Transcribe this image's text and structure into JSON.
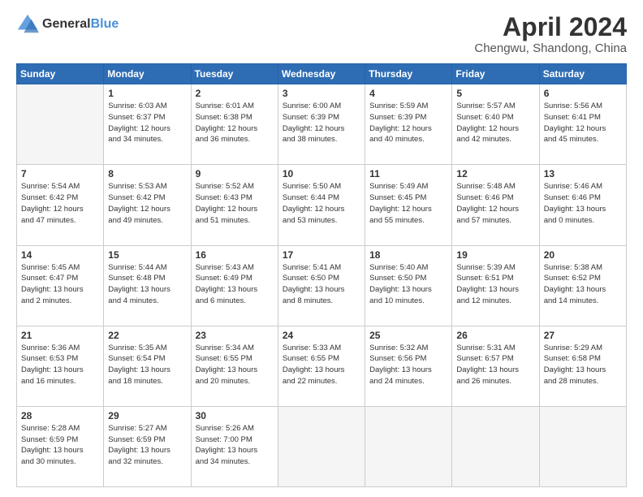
{
  "header": {
    "logo_line1": "General",
    "logo_line2": "Blue",
    "month_title": "April 2024",
    "location": "Chengwu, Shandong, China"
  },
  "days_of_week": [
    "Sunday",
    "Monday",
    "Tuesday",
    "Wednesday",
    "Thursday",
    "Friday",
    "Saturday"
  ],
  "weeks": [
    [
      {
        "day": "",
        "info": ""
      },
      {
        "day": "1",
        "info": "Sunrise: 6:03 AM\nSunset: 6:37 PM\nDaylight: 12 hours\nand 34 minutes."
      },
      {
        "day": "2",
        "info": "Sunrise: 6:01 AM\nSunset: 6:38 PM\nDaylight: 12 hours\nand 36 minutes."
      },
      {
        "day": "3",
        "info": "Sunrise: 6:00 AM\nSunset: 6:39 PM\nDaylight: 12 hours\nand 38 minutes."
      },
      {
        "day": "4",
        "info": "Sunrise: 5:59 AM\nSunset: 6:39 PM\nDaylight: 12 hours\nand 40 minutes."
      },
      {
        "day": "5",
        "info": "Sunrise: 5:57 AM\nSunset: 6:40 PM\nDaylight: 12 hours\nand 42 minutes."
      },
      {
        "day": "6",
        "info": "Sunrise: 5:56 AM\nSunset: 6:41 PM\nDaylight: 12 hours\nand 45 minutes."
      }
    ],
    [
      {
        "day": "7",
        "info": "Sunrise: 5:54 AM\nSunset: 6:42 PM\nDaylight: 12 hours\nand 47 minutes."
      },
      {
        "day": "8",
        "info": "Sunrise: 5:53 AM\nSunset: 6:42 PM\nDaylight: 12 hours\nand 49 minutes."
      },
      {
        "day": "9",
        "info": "Sunrise: 5:52 AM\nSunset: 6:43 PM\nDaylight: 12 hours\nand 51 minutes."
      },
      {
        "day": "10",
        "info": "Sunrise: 5:50 AM\nSunset: 6:44 PM\nDaylight: 12 hours\nand 53 minutes."
      },
      {
        "day": "11",
        "info": "Sunrise: 5:49 AM\nSunset: 6:45 PM\nDaylight: 12 hours\nand 55 minutes."
      },
      {
        "day": "12",
        "info": "Sunrise: 5:48 AM\nSunset: 6:46 PM\nDaylight: 12 hours\nand 57 minutes."
      },
      {
        "day": "13",
        "info": "Sunrise: 5:46 AM\nSunset: 6:46 PM\nDaylight: 13 hours\nand 0 minutes."
      }
    ],
    [
      {
        "day": "14",
        "info": "Sunrise: 5:45 AM\nSunset: 6:47 PM\nDaylight: 13 hours\nand 2 minutes."
      },
      {
        "day": "15",
        "info": "Sunrise: 5:44 AM\nSunset: 6:48 PM\nDaylight: 13 hours\nand 4 minutes."
      },
      {
        "day": "16",
        "info": "Sunrise: 5:43 AM\nSunset: 6:49 PM\nDaylight: 13 hours\nand 6 minutes."
      },
      {
        "day": "17",
        "info": "Sunrise: 5:41 AM\nSunset: 6:50 PM\nDaylight: 13 hours\nand 8 minutes."
      },
      {
        "day": "18",
        "info": "Sunrise: 5:40 AM\nSunset: 6:50 PM\nDaylight: 13 hours\nand 10 minutes."
      },
      {
        "day": "19",
        "info": "Sunrise: 5:39 AM\nSunset: 6:51 PM\nDaylight: 13 hours\nand 12 minutes."
      },
      {
        "day": "20",
        "info": "Sunrise: 5:38 AM\nSunset: 6:52 PM\nDaylight: 13 hours\nand 14 minutes."
      }
    ],
    [
      {
        "day": "21",
        "info": "Sunrise: 5:36 AM\nSunset: 6:53 PM\nDaylight: 13 hours\nand 16 minutes."
      },
      {
        "day": "22",
        "info": "Sunrise: 5:35 AM\nSunset: 6:54 PM\nDaylight: 13 hours\nand 18 minutes."
      },
      {
        "day": "23",
        "info": "Sunrise: 5:34 AM\nSunset: 6:55 PM\nDaylight: 13 hours\nand 20 minutes."
      },
      {
        "day": "24",
        "info": "Sunrise: 5:33 AM\nSunset: 6:55 PM\nDaylight: 13 hours\nand 22 minutes."
      },
      {
        "day": "25",
        "info": "Sunrise: 5:32 AM\nSunset: 6:56 PM\nDaylight: 13 hours\nand 24 minutes."
      },
      {
        "day": "26",
        "info": "Sunrise: 5:31 AM\nSunset: 6:57 PM\nDaylight: 13 hours\nand 26 minutes."
      },
      {
        "day": "27",
        "info": "Sunrise: 5:29 AM\nSunset: 6:58 PM\nDaylight: 13 hours\nand 28 minutes."
      }
    ],
    [
      {
        "day": "28",
        "info": "Sunrise: 5:28 AM\nSunset: 6:59 PM\nDaylight: 13 hours\nand 30 minutes."
      },
      {
        "day": "29",
        "info": "Sunrise: 5:27 AM\nSunset: 6:59 PM\nDaylight: 13 hours\nand 32 minutes."
      },
      {
        "day": "30",
        "info": "Sunrise: 5:26 AM\nSunset: 7:00 PM\nDaylight: 13 hours\nand 34 minutes."
      },
      {
        "day": "",
        "info": ""
      },
      {
        "day": "",
        "info": ""
      },
      {
        "day": "",
        "info": ""
      },
      {
        "day": "",
        "info": ""
      }
    ]
  ]
}
